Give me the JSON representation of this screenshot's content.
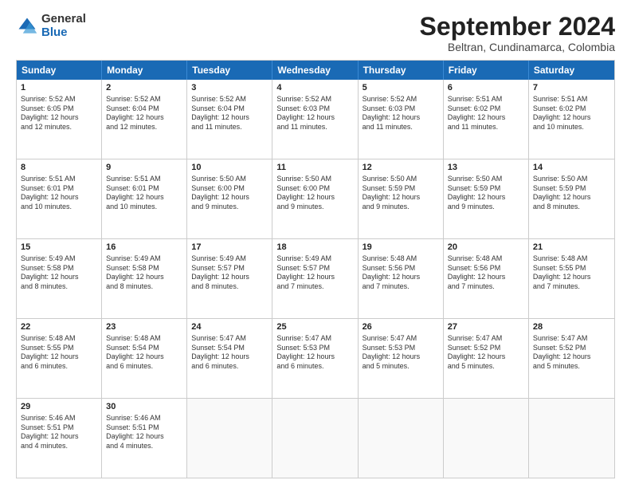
{
  "logo": {
    "general": "General",
    "blue": "Blue"
  },
  "title": "September 2024",
  "subtitle": "Beltran, Cundinamarca, Colombia",
  "header_days": [
    "Sunday",
    "Monday",
    "Tuesday",
    "Wednesday",
    "Thursday",
    "Friday",
    "Saturday"
  ],
  "weeks": [
    [
      {
        "day": "1",
        "text": "Sunrise: 5:52 AM\nSunset: 6:05 PM\nDaylight: 12 hours\nand 12 minutes."
      },
      {
        "day": "2",
        "text": "Sunrise: 5:52 AM\nSunset: 6:04 PM\nDaylight: 12 hours\nand 12 minutes."
      },
      {
        "day": "3",
        "text": "Sunrise: 5:52 AM\nSunset: 6:04 PM\nDaylight: 12 hours\nand 11 minutes."
      },
      {
        "day": "4",
        "text": "Sunrise: 5:52 AM\nSunset: 6:03 PM\nDaylight: 12 hours\nand 11 minutes."
      },
      {
        "day": "5",
        "text": "Sunrise: 5:52 AM\nSunset: 6:03 PM\nDaylight: 12 hours\nand 11 minutes."
      },
      {
        "day": "6",
        "text": "Sunrise: 5:51 AM\nSunset: 6:02 PM\nDaylight: 12 hours\nand 11 minutes."
      },
      {
        "day": "7",
        "text": "Sunrise: 5:51 AM\nSunset: 6:02 PM\nDaylight: 12 hours\nand 10 minutes."
      }
    ],
    [
      {
        "day": "8",
        "text": "Sunrise: 5:51 AM\nSunset: 6:01 PM\nDaylight: 12 hours\nand 10 minutes."
      },
      {
        "day": "9",
        "text": "Sunrise: 5:51 AM\nSunset: 6:01 PM\nDaylight: 12 hours\nand 10 minutes."
      },
      {
        "day": "10",
        "text": "Sunrise: 5:50 AM\nSunset: 6:00 PM\nDaylight: 12 hours\nand 9 minutes."
      },
      {
        "day": "11",
        "text": "Sunrise: 5:50 AM\nSunset: 6:00 PM\nDaylight: 12 hours\nand 9 minutes."
      },
      {
        "day": "12",
        "text": "Sunrise: 5:50 AM\nSunset: 5:59 PM\nDaylight: 12 hours\nand 9 minutes."
      },
      {
        "day": "13",
        "text": "Sunrise: 5:50 AM\nSunset: 5:59 PM\nDaylight: 12 hours\nand 9 minutes."
      },
      {
        "day": "14",
        "text": "Sunrise: 5:50 AM\nSunset: 5:59 PM\nDaylight: 12 hours\nand 8 minutes."
      }
    ],
    [
      {
        "day": "15",
        "text": "Sunrise: 5:49 AM\nSunset: 5:58 PM\nDaylight: 12 hours\nand 8 minutes."
      },
      {
        "day": "16",
        "text": "Sunrise: 5:49 AM\nSunset: 5:58 PM\nDaylight: 12 hours\nand 8 minutes."
      },
      {
        "day": "17",
        "text": "Sunrise: 5:49 AM\nSunset: 5:57 PM\nDaylight: 12 hours\nand 8 minutes."
      },
      {
        "day": "18",
        "text": "Sunrise: 5:49 AM\nSunset: 5:57 PM\nDaylight: 12 hours\nand 7 minutes."
      },
      {
        "day": "19",
        "text": "Sunrise: 5:48 AM\nSunset: 5:56 PM\nDaylight: 12 hours\nand 7 minutes."
      },
      {
        "day": "20",
        "text": "Sunrise: 5:48 AM\nSunset: 5:56 PM\nDaylight: 12 hours\nand 7 minutes."
      },
      {
        "day": "21",
        "text": "Sunrise: 5:48 AM\nSunset: 5:55 PM\nDaylight: 12 hours\nand 7 minutes."
      }
    ],
    [
      {
        "day": "22",
        "text": "Sunrise: 5:48 AM\nSunset: 5:55 PM\nDaylight: 12 hours\nand 6 minutes."
      },
      {
        "day": "23",
        "text": "Sunrise: 5:48 AM\nSunset: 5:54 PM\nDaylight: 12 hours\nand 6 minutes."
      },
      {
        "day": "24",
        "text": "Sunrise: 5:47 AM\nSunset: 5:54 PM\nDaylight: 12 hours\nand 6 minutes."
      },
      {
        "day": "25",
        "text": "Sunrise: 5:47 AM\nSunset: 5:53 PM\nDaylight: 12 hours\nand 6 minutes."
      },
      {
        "day": "26",
        "text": "Sunrise: 5:47 AM\nSunset: 5:53 PM\nDaylight: 12 hours\nand 5 minutes."
      },
      {
        "day": "27",
        "text": "Sunrise: 5:47 AM\nSunset: 5:52 PM\nDaylight: 12 hours\nand 5 minutes."
      },
      {
        "day": "28",
        "text": "Sunrise: 5:47 AM\nSunset: 5:52 PM\nDaylight: 12 hours\nand 5 minutes."
      }
    ],
    [
      {
        "day": "29",
        "text": "Sunrise: 5:46 AM\nSunset: 5:51 PM\nDaylight: 12 hours\nand 4 minutes."
      },
      {
        "day": "30",
        "text": "Sunrise: 5:46 AM\nSunset: 5:51 PM\nDaylight: 12 hours\nand 4 minutes."
      },
      {
        "day": "",
        "text": ""
      },
      {
        "day": "",
        "text": ""
      },
      {
        "day": "",
        "text": ""
      },
      {
        "day": "",
        "text": ""
      },
      {
        "day": "",
        "text": ""
      }
    ]
  ]
}
